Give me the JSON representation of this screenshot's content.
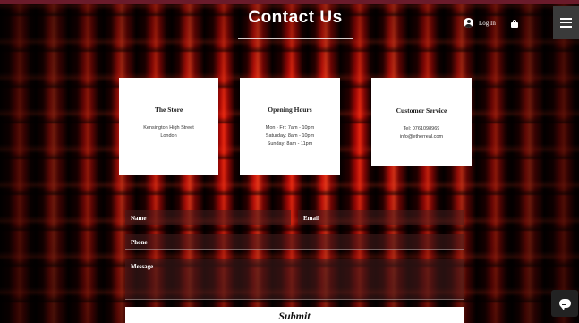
{
  "header": {
    "title": "Contact Us",
    "login_label": "Log In",
    "icons": {
      "user": "user-icon",
      "cart": "cart-icon",
      "menu": "hamburger-menu-icon"
    }
  },
  "cards": {
    "store": {
      "title": "The Store",
      "lines": [
        "Kensington High Street",
        "London"
      ]
    },
    "hours": {
      "title": "Opening Hours",
      "lines": [
        "Mon - Fri: 7am - 10pm",
        "Saturday: 8am - 10pm",
        "Sunday: 8am - 11pm"
      ]
    },
    "service": {
      "title": "Customer Service",
      "lines": [
        "Tel: 0761098969",
        "info@etherreal.com"
      ]
    }
  },
  "form": {
    "name_label": "Name",
    "email_label": "Email",
    "phone_label": "Phone",
    "message_label": "Message",
    "submit_label": "Submit"
  },
  "colors": {
    "accent_red": "#ff2a10",
    "menu_bg": "#3a3a3a",
    "chat_bg": "#222222"
  }
}
